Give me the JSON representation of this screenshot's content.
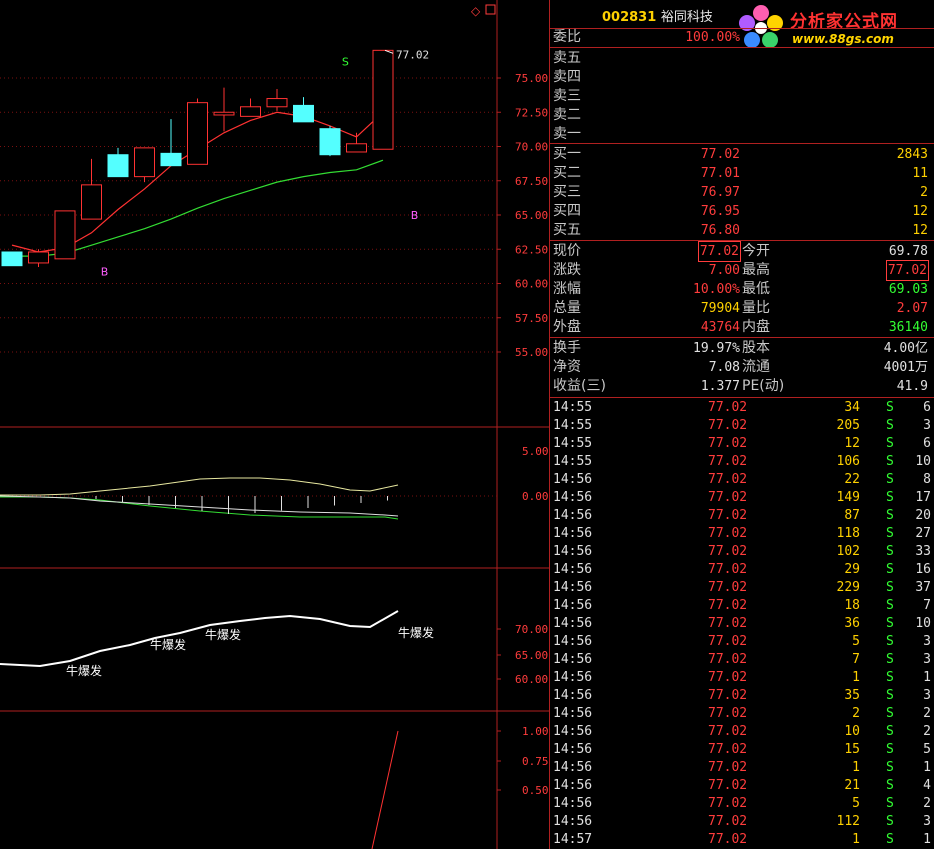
{
  "stock": {
    "code": "002831",
    "name": "裕同科技"
  },
  "logo": {
    "title": "分析家公式网",
    "url": "www.88gs.com"
  },
  "chart": {
    "candles": [
      {
        "o": 62.3,
        "c": 61.3,
        "h": 62.3,
        "l": 61.3
      },
      {
        "o": 61.5,
        "c": 62.3,
        "h": 62.5,
        "l": 61.2
      },
      {
        "o": 61.8,
        "c": 65.3,
        "h": 65.3,
        "l": 61.8
      },
      {
        "o": 64.7,
        "c": 67.2,
        "h": 69.1,
        "l": 64.7
      },
      {
        "o": 69.4,
        "c": 67.8,
        "h": 69.9,
        "l": 67.8
      },
      {
        "o": 67.8,
        "c": 69.9,
        "h": 69.9,
        "l": 67.4
      },
      {
        "o": 69.5,
        "c": 68.6,
        "h": 72.0,
        "l": 68.6
      },
      {
        "o": 68.7,
        "c": 73.2,
        "h": 73.5,
        "l": 68.7
      },
      {
        "o": 72.3,
        "c": 72.5,
        "h": 74.3,
        "l": 71.1
      },
      {
        "o": 72.2,
        "c": 72.9,
        "h": 73.5,
        "l": 72.2
      },
      {
        "o": 72.9,
        "c": 73.5,
        "h": 74.2,
        "l": 72.6
      },
      {
        "o": 73.0,
        "c": 71.8,
        "h": 73.6,
        "l": 71.8
      },
      {
        "o": 71.3,
        "c": 69.4,
        "h": 71.5,
        "l": 69.3
      },
      {
        "o": 69.6,
        "c": 70.2,
        "h": 71.0,
        "l": 69.6
      },
      {
        "o": 69.8,
        "c": 77.02,
        "h": 77.02,
        "l": 69.8
      }
    ],
    "price_axis": [
      "75.00",
      "72.50",
      "70.00",
      "67.50",
      "65.00",
      "62.50",
      "60.00",
      "57.50",
      "55.00"
    ],
    "high_label": "77.02",
    "ma_red": [
      62.8,
      62.3,
      62.6,
      63.7,
      65.4,
      66.9,
      68.6,
      69.8,
      71.0,
      71.9,
      72.5,
      72.2,
      71.5,
      70.7,
      72.5
    ],
    "ma_green": [
      62.0,
      62.0,
      62.2,
      62.8,
      63.4,
      64.0,
      64.7,
      65.5,
      66.2,
      66.8,
      67.4,
      67.8,
      68.1,
      68.3,
      69.0
    ],
    "signals": [
      {
        "type": "B",
        "i": 3.5,
        "v": 60.6
      },
      {
        "type": "S",
        "i": 12.6,
        "v": 75.9
      },
      {
        "type": "B",
        "i": 15.2,
        "v": 64.7
      }
    ],
    "macd_axis": [
      "5.00",
      "0.00"
    ],
    "mid_axis": [
      "70.00",
      "65.00",
      "60.00"
    ],
    "bottom_axis": [
      "1.00",
      "0.75",
      "0.50"
    ],
    "signal_label": "牛爆发"
  },
  "panel": {
    "wei_bi": {
      "label": "委比",
      "value": "100.00%"
    },
    "sell_labels": [
      "卖五",
      "卖四",
      "卖三",
      "卖二",
      "卖一"
    ],
    "buys": [
      {
        "label": "买一",
        "price": "77.02",
        "vol": "2843"
      },
      {
        "label": "买二",
        "price": "77.01",
        "vol": "11"
      },
      {
        "label": "买三",
        "price": "76.97",
        "vol": "2"
      },
      {
        "label": "买四",
        "price": "76.95",
        "vol": "12"
      },
      {
        "label": "买五",
        "price": "76.80",
        "vol": "12"
      }
    ],
    "quote": [
      {
        "l1": "现价",
        "v1": "77.02",
        "l2": "今开",
        "v2": "69.78"
      },
      {
        "l1": "涨跌",
        "v1": "7.00",
        "l2": "最高",
        "v2": "77.02"
      },
      {
        "l1": "涨幅",
        "v1": "10.00%",
        "l2": "最低",
        "v2": "69.03"
      },
      {
        "l1": "总量",
        "v1": "79904",
        "l2": "量比",
        "v2": "2.07"
      },
      {
        "l1": "外盘",
        "v1": "43764",
        "l2": "内盘",
        "v2": "36140"
      }
    ],
    "fin": [
      {
        "l1": "换手",
        "v1": "19.97%",
        "l2": "股本",
        "v2": "4.00亿"
      },
      {
        "l1": "净资",
        "v1": "7.08",
        "l2": "流通",
        "v2": "4001万"
      },
      {
        "l1": "收益(三)",
        "v1": "1.377",
        "l2": "PE(动)",
        "v2": "41.9"
      }
    ],
    "ticks": [
      {
        "t": "14:55",
        "p": "77.02",
        "v": "34",
        "bs": "S",
        "n": "6"
      },
      {
        "t": "14:55",
        "p": "77.02",
        "v": "205",
        "bs": "S",
        "n": "3"
      },
      {
        "t": "14:55",
        "p": "77.02",
        "v": "12",
        "bs": "S",
        "n": "6"
      },
      {
        "t": "14:55",
        "p": "77.02",
        "v": "106",
        "bs": "S",
        "n": "10"
      },
      {
        "t": "14:56",
        "p": "77.02",
        "v": "22",
        "bs": "S",
        "n": "8"
      },
      {
        "t": "14:56",
        "p": "77.02",
        "v": "149",
        "bs": "S",
        "n": "17"
      },
      {
        "t": "14:56",
        "p": "77.02",
        "v": "87",
        "bs": "S",
        "n": "20"
      },
      {
        "t": "14:56",
        "p": "77.02",
        "v": "118",
        "bs": "S",
        "n": "27"
      },
      {
        "t": "14:56",
        "p": "77.02",
        "v": "102",
        "bs": "S",
        "n": "33"
      },
      {
        "t": "14:56",
        "p": "77.02",
        "v": "29",
        "bs": "S",
        "n": "16"
      },
      {
        "t": "14:56",
        "p": "77.02",
        "v": "229",
        "bs": "S",
        "n": "37"
      },
      {
        "t": "14:56",
        "p": "77.02",
        "v": "18",
        "bs": "S",
        "n": "7"
      },
      {
        "t": "14:56",
        "p": "77.02",
        "v": "36",
        "bs": "S",
        "n": "10"
      },
      {
        "t": "14:56",
        "p": "77.02",
        "v": "5",
        "bs": "S",
        "n": "3"
      },
      {
        "t": "14:56",
        "p": "77.02",
        "v": "7",
        "bs": "S",
        "n": "3"
      },
      {
        "t": "14:56",
        "p": "77.02",
        "v": "1",
        "bs": "S",
        "n": "1"
      },
      {
        "t": "14:56",
        "p": "77.02",
        "v": "35",
        "bs": "S",
        "n": "3"
      },
      {
        "t": "14:56",
        "p": "77.02",
        "v": "2",
        "bs": "S",
        "n": "2"
      },
      {
        "t": "14:56",
        "p": "77.02",
        "v": "10",
        "bs": "S",
        "n": "2"
      },
      {
        "t": "14:56",
        "p": "77.02",
        "v": "15",
        "bs": "S",
        "n": "5"
      },
      {
        "t": "14:56",
        "p": "77.02",
        "v": "1",
        "bs": "S",
        "n": "1"
      },
      {
        "t": "14:56",
        "p": "77.02",
        "v": "21",
        "bs": "S",
        "n": "4"
      },
      {
        "t": "14:56",
        "p": "77.02",
        "v": "5",
        "bs": "S",
        "n": "2"
      },
      {
        "t": "14:56",
        "p": "77.02",
        "v": "112",
        "bs": "S",
        "n": "3"
      },
      {
        "t": "14:57",
        "p": "77.02",
        "v": "1",
        "bs": "S",
        "n": "1"
      }
    ]
  },
  "colors": {
    "up": "#ff3232",
    "down": "#54ffff",
    "grid": "#b02020",
    "ma_red": "#ff3232",
    "ma_green": "#33dd33"
  }
}
